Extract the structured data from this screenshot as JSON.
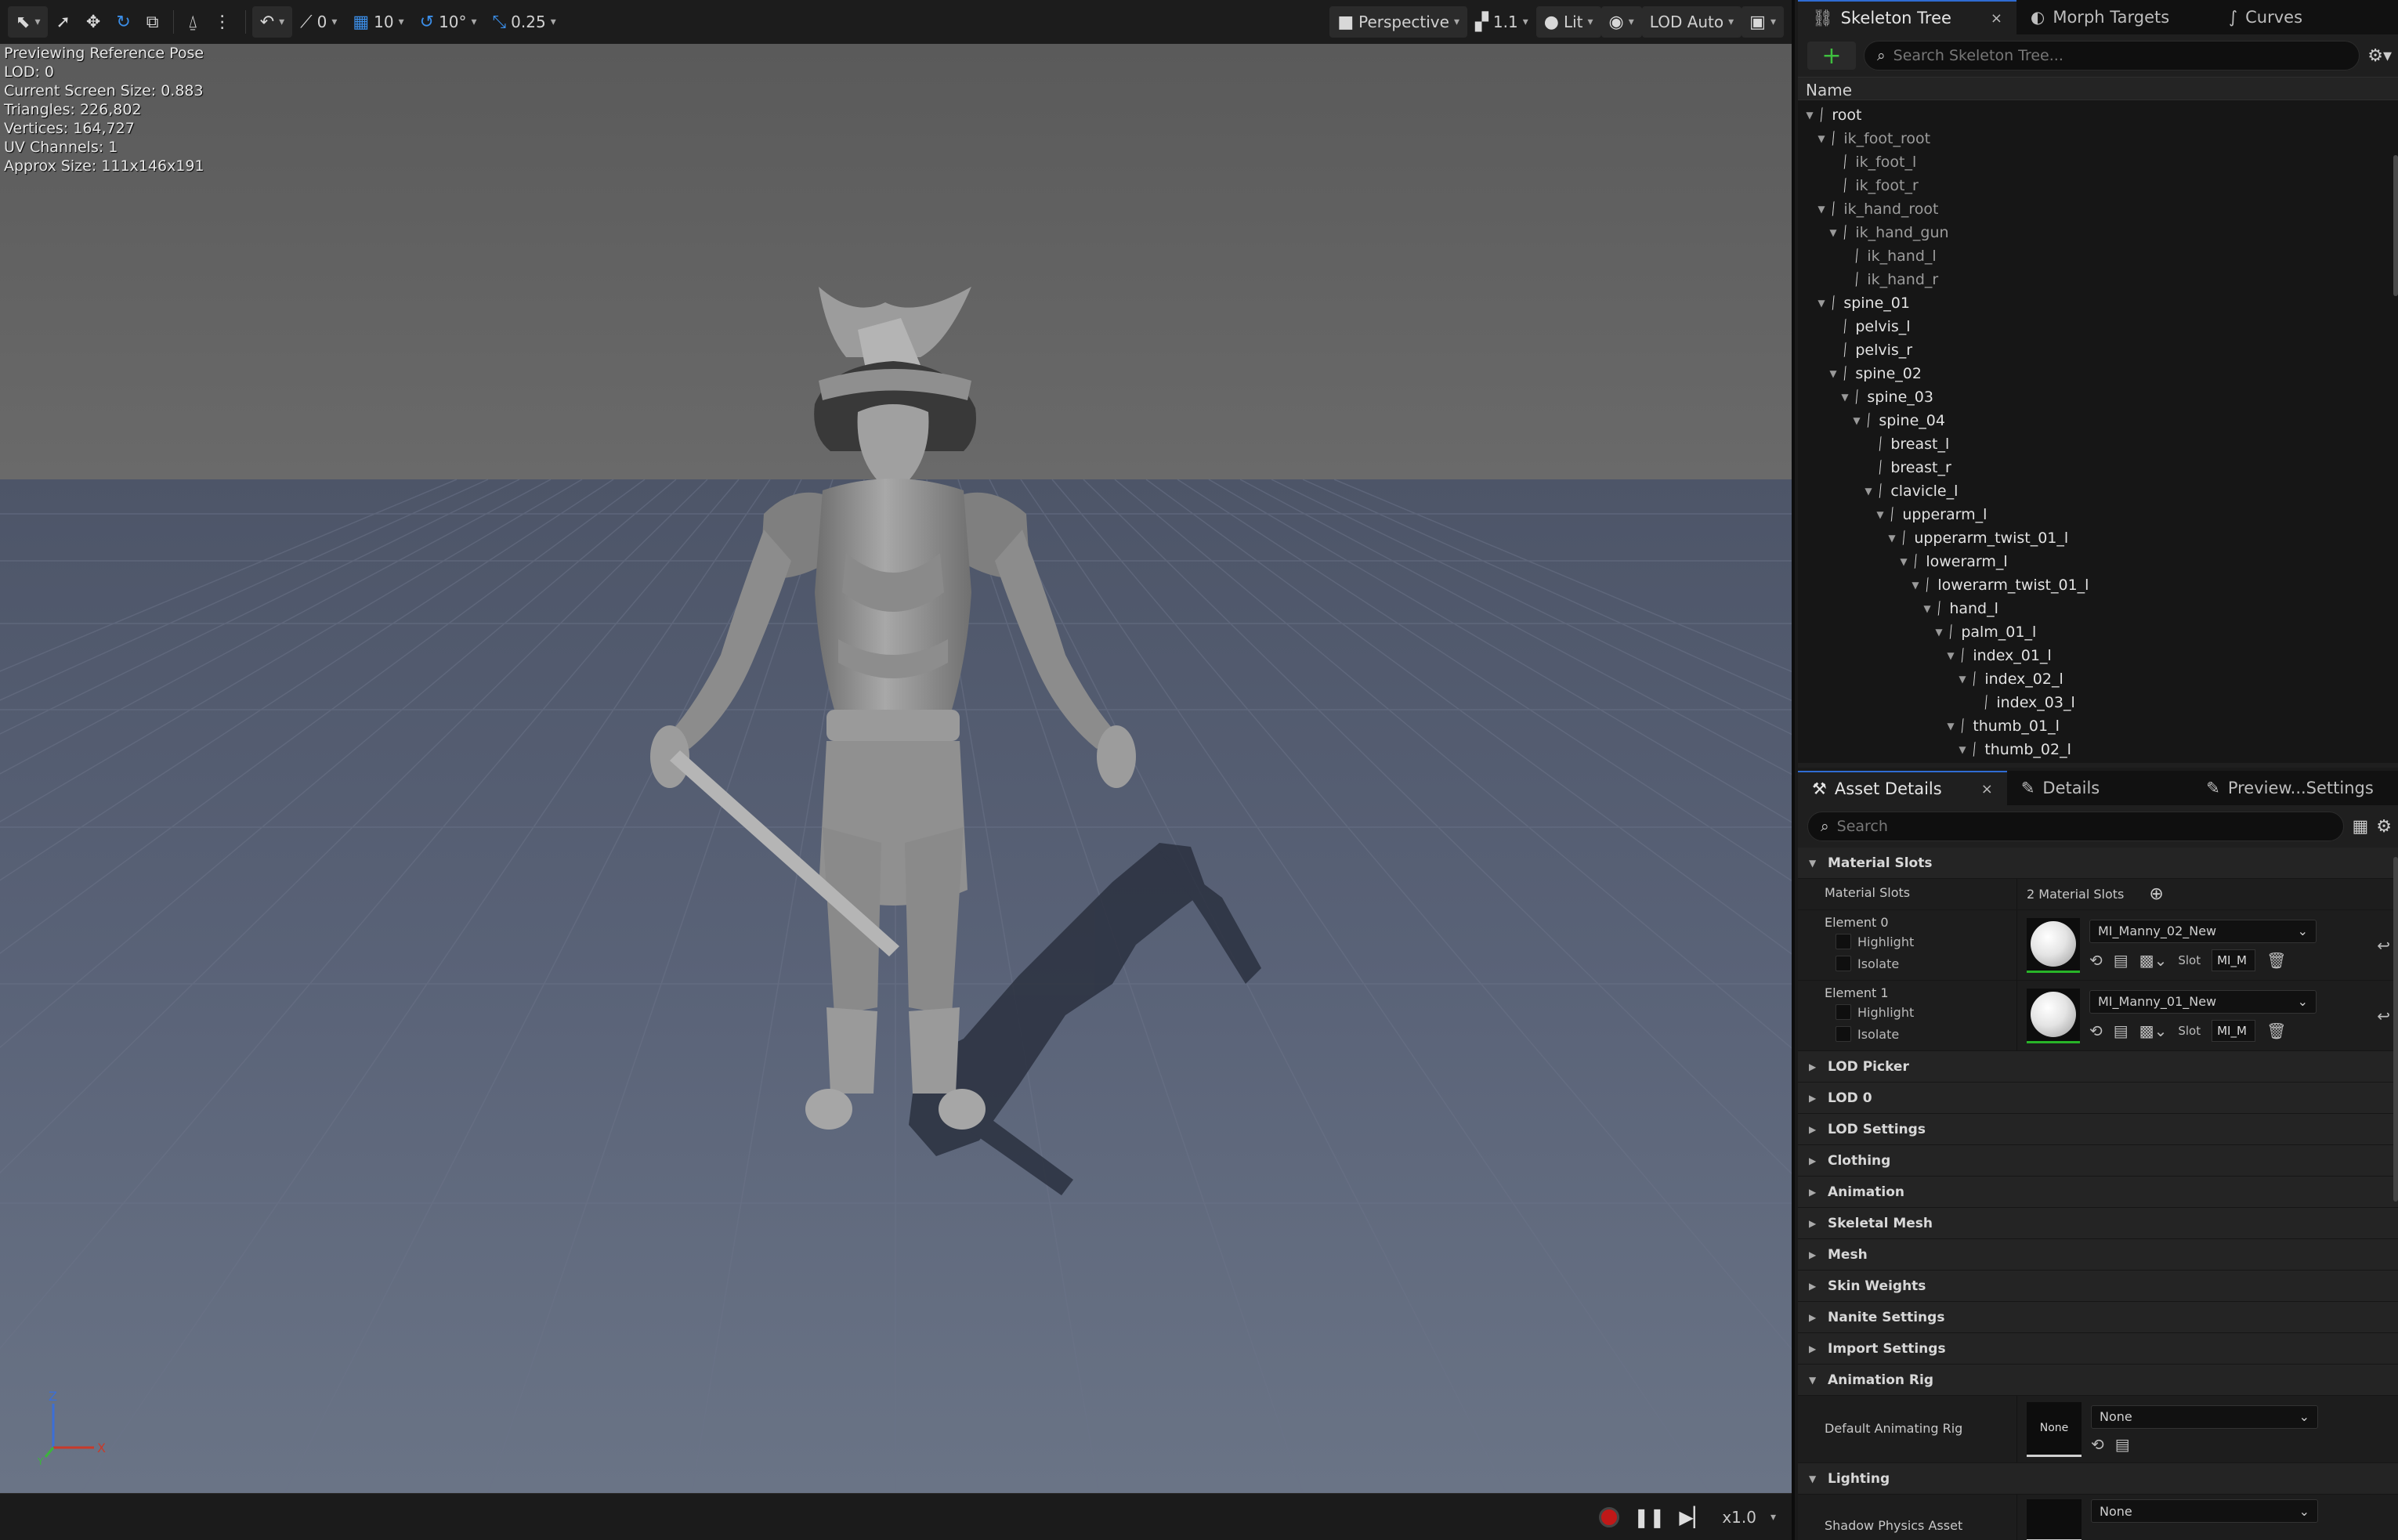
{
  "toolbar": {
    "snap_location": "0",
    "grid_snap": "10",
    "rotation_snap": "10°",
    "scale_snap": "0.25",
    "view_mode": "Perspective",
    "camera_speed": "1.1",
    "lighting_mode": "Lit",
    "lod": "LOD Auto"
  },
  "stats": {
    "line1": "Previewing Reference Pose",
    "line2": "LOD: 0",
    "line3": "Current Screen Size: 0.883",
    "line4": "Triangles: 226,802",
    "line5": "Vertices: 164,727",
    "line6": "UV Channels: 1",
    "line7": "Approx Size: 111x146x191"
  },
  "axis": {
    "z": "Z",
    "x": "X",
    "y": "Y"
  },
  "playback": {
    "speed": "x1.0"
  },
  "skeleton_panel": {
    "tabs": [
      "Skeleton Tree",
      "Morph Targets",
      "Curves"
    ],
    "search_placeholder": "Search Skeleton Tree...",
    "column_header": "Name",
    "bones": [
      {
        "name": "root",
        "depth": 0,
        "expanded": true,
        "dim": false
      },
      {
        "name": "ik_foot_root",
        "depth": 1,
        "expanded": true,
        "dim": true
      },
      {
        "name": "ik_foot_l",
        "depth": 2,
        "expanded": false,
        "dim": true
      },
      {
        "name": "ik_foot_r",
        "depth": 2,
        "expanded": false,
        "dim": true
      },
      {
        "name": "ik_hand_root",
        "depth": 1,
        "expanded": true,
        "dim": true
      },
      {
        "name": "ik_hand_gun",
        "depth": 2,
        "expanded": true,
        "dim": true
      },
      {
        "name": "ik_hand_l",
        "depth": 3,
        "expanded": false,
        "dim": true
      },
      {
        "name": "ik_hand_r",
        "depth": 3,
        "expanded": false,
        "dim": true
      },
      {
        "name": "spine_01",
        "depth": 1,
        "expanded": true,
        "dim": false
      },
      {
        "name": "pelvis_l",
        "depth": 2,
        "expanded": false,
        "dim": false
      },
      {
        "name": "pelvis_r",
        "depth": 2,
        "expanded": false,
        "dim": false
      },
      {
        "name": "spine_02",
        "depth": 2,
        "expanded": true,
        "dim": false
      },
      {
        "name": "spine_03",
        "depth": 3,
        "expanded": true,
        "dim": false
      },
      {
        "name": "spine_04",
        "depth": 4,
        "expanded": true,
        "dim": false
      },
      {
        "name": "breast_l",
        "depth": 5,
        "expanded": false,
        "dim": false
      },
      {
        "name": "breast_r",
        "depth": 5,
        "expanded": false,
        "dim": false
      },
      {
        "name": "clavicle_l",
        "depth": 5,
        "expanded": true,
        "dim": false
      },
      {
        "name": "upperarm_l",
        "depth": 6,
        "expanded": true,
        "dim": false
      },
      {
        "name": "upperarm_twist_01_l",
        "depth": 7,
        "expanded": true,
        "dim": false
      },
      {
        "name": "lowerarm_l",
        "depth": 8,
        "expanded": true,
        "dim": false
      },
      {
        "name": "lowerarm_twist_01_l",
        "depth": 9,
        "expanded": true,
        "dim": false
      },
      {
        "name": "hand_l",
        "depth": 10,
        "expanded": true,
        "dim": false
      },
      {
        "name": "palm_01_l",
        "depth": 11,
        "expanded": true,
        "dim": false
      },
      {
        "name": "index_01_l",
        "depth": 12,
        "expanded": true,
        "dim": false
      },
      {
        "name": "index_02_l",
        "depth": 13,
        "expanded": true,
        "dim": false
      },
      {
        "name": "index_03_l",
        "depth": 14,
        "expanded": false,
        "dim": false
      },
      {
        "name": "thumb_01_l",
        "depth": 12,
        "expanded": true,
        "dim": false
      },
      {
        "name": "thumb_02_l",
        "depth": 13,
        "expanded": true,
        "dim": false
      }
    ]
  },
  "details_panel": {
    "tabs": [
      "Asset Details",
      "Details",
      "Preview...Settings"
    ],
    "search_placeholder": "Search",
    "material_slots": {
      "section": "Material Slots",
      "label": "Material Slots",
      "count": "2 Material Slots",
      "elements": [
        {
          "name": "Element 0",
          "highlight": "Highlight",
          "isolate": "Isolate",
          "material": "MI_Manny_02_New",
          "slot_label": "Slot",
          "slot": "MI_M"
        },
        {
          "name": "Element 1",
          "highlight": "Highlight",
          "isolate": "Isolate",
          "material": "MI_Manny_01_New",
          "slot_label": "Slot",
          "slot": "MI_M"
        }
      ]
    },
    "collapsed_sections": [
      "LOD Picker",
      "LOD 0",
      "LOD Settings",
      "Clothing",
      "Animation",
      "Skeletal Mesh",
      "Mesh",
      "Skin Weights",
      "Nanite Settings",
      "Import Settings"
    ],
    "animation_rig": {
      "section": "Animation Rig",
      "label": "Default Animating Rig",
      "thumb": "None",
      "value": "None"
    },
    "lighting": {
      "section": "Lighting",
      "label": "Shadow Physics Asset",
      "value": "None"
    }
  },
  "colors": {
    "accent": "#2f6cd2",
    "add_green": "#3fbf3f",
    "record_red": "#c01818",
    "sky": "#606060",
    "floor": "#5a6477"
  }
}
